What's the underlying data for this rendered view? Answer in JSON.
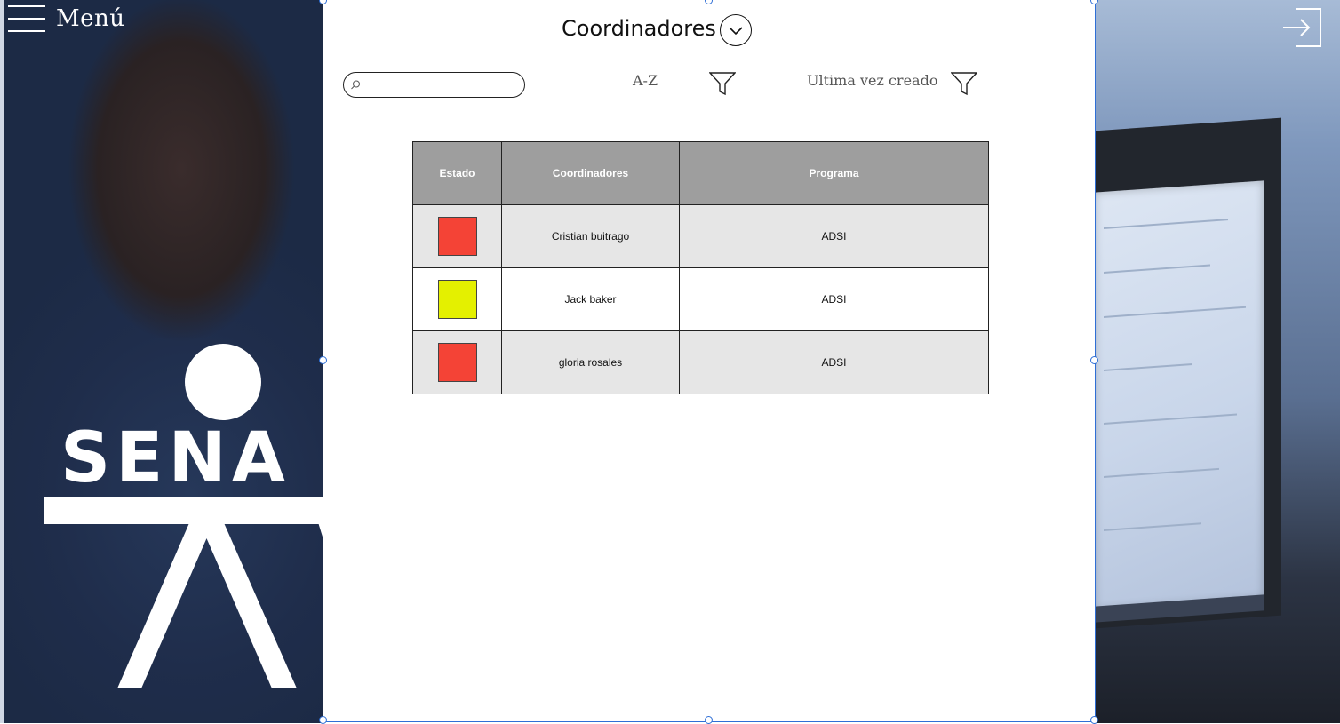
{
  "menu": {
    "label": "Menú"
  },
  "logo": {
    "text": "SENA"
  },
  "header": {
    "title": "Coordinadores"
  },
  "search": {
    "placeholder": "",
    "value": ""
  },
  "filters": [
    {
      "label": "A-Z"
    },
    {
      "label": "Ultima vez creado"
    }
  ],
  "table": {
    "columns": [
      "Estado",
      "Coordinadores",
      "Programa"
    ],
    "rows": [
      {
        "status_color": "#f44336",
        "coordinator": "Cristian buitrago",
        "program": "ADSI"
      },
      {
        "status_color": "#e4f000",
        "coordinator": "Jack baker",
        "program": "ADSI"
      },
      {
        "status_color": "#f44336",
        "coordinator": "gloria rosales",
        "program": "ADSI"
      }
    ]
  },
  "colors": {
    "selection": "#2f6fd6",
    "header_bg": "#9e9e9e",
    "row_alt_bg": "#e6e6e6"
  },
  "icons": [
    "hamburger-menu-icon",
    "exit-icon",
    "chevron-down-icon",
    "search-icon",
    "filter-icon"
  ]
}
